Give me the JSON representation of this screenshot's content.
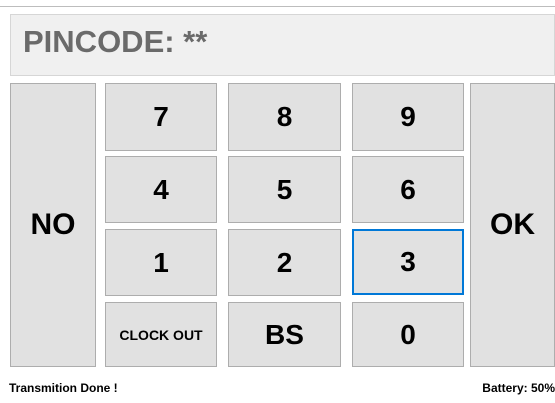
{
  "pincode": {
    "label": "PINCODE: **"
  },
  "buttons": {
    "no": "NO",
    "ok": "OK",
    "k7": "7",
    "k8": "8",
    "k9": "9",
    "k4": "4",
    "k5": "5",
    "k6": "6",
    "k1": "1",
    "k2": "2",
    "k3": "3",
    "clock_out": "CLOCK OUT",
    "bs": "BS",
    "k0": "0"
  },
  "status": {
    "message": "Transmition Done !",
    "battery": "Battery: 50%"
  },
  "colors": {
    "button_bg": "#e1e1e1",
    "focus_border": "#0078d7",
    "header_bg": "#f0f0f0",
    "title_text": "#6a6a6a"
  }
}
